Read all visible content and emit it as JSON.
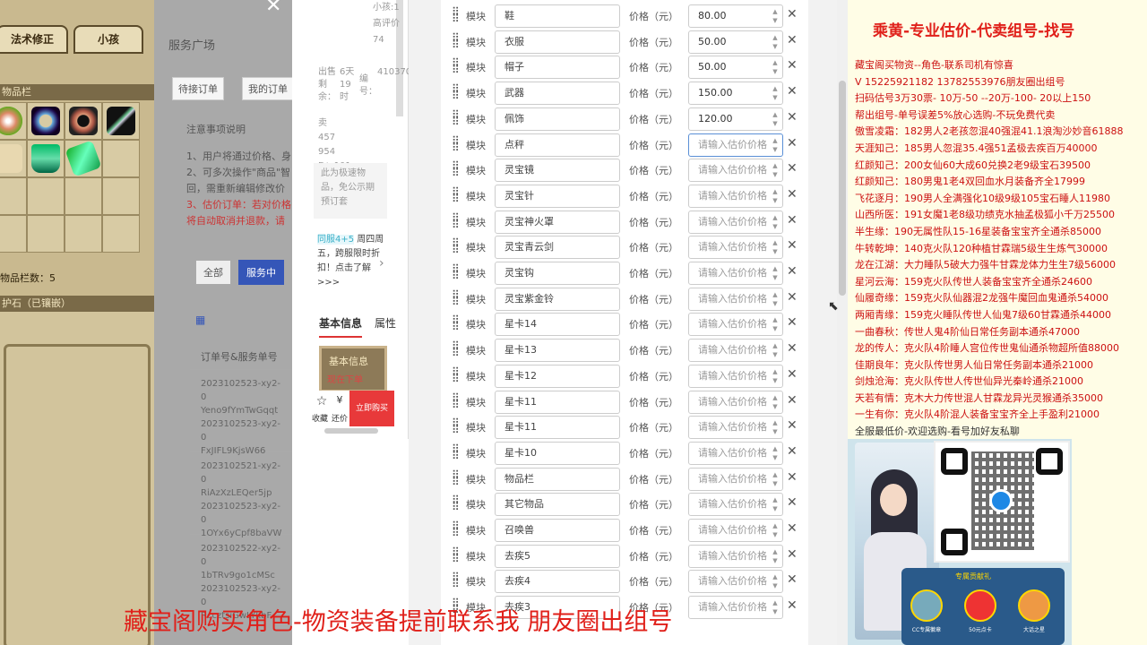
{
  "game": {
    "tab1": "法术修正",
    "tab2": "小孩",
    "bag_title": "物品栏",
    "bag_count": "物品栏数：5",
    "stone_title": "护石（已镶嵌）"
  },
  "service": {
    "title": "服务广场",
    "tab_pending": "待接订单",
    "tab_mine": "我的订单",
    "notes_title": "注意事项说明",
    "note1": "1、用户将通过价格、身",
    "note2": "2、可多次操作\"商品\"智",
    "note3": "回，需重新编辑修改价",
    "note4": "3、估价订单：若对价格",
    "note5": "将自动取消并退款，请",
    "filter_all": "全部",
    "filter_active": "服务中",
    "view_icon": "▦",
    "col_order": "订单号&服务单号",
    "orders": [
      [
        "2023102523-xy2-0",
        "Yeno9fYmTwGqqt",
        "2023102523-xy2-0",
        "FxJIFL9KjsW66"
      ],
      [
        "2023102521-xy2-0",
        "RiAzXzLEQer5jp",
        "2023102523-xy2-0",
        "1OYx6yCpf8baVW"
      ],
      [
        "2023102522-xy2-0",
        "1bTRv9go1cMSc",
        "2023102523-xy2-0",
        "RccztsiGwLYkbF"
      ]
    ]
  },
  "product": {
    "top_small": "小孩:1",
    "top_note": "高评价",
    "top_num": "74",
    "sale_label": "出售剩余：",
    "sale_value": "6天19时",
    "id_label": "编号：",
    "id_value": "410370",
    "stat1": "卖",
    "stat2": "457",
    "stat3": "954",
    "stat4": "D：101",
    "notice": "此为极速物品，免公示期预订套",
    "promo_tag": "同服4+5",
    "promo_text": "周四周五，跨服限时折扣！点击了解>>>",
    "tab_basic": "基本信息",
    "tab_attr": "属性",
    "img_title": "基本信息",
    "img_sub": "现在下单",
    "fav": "收藏",
    "compare": "还价",
    "buy": "立即购买"
  },
  "form": {
    "module_label": "模块",
    "price_label": "价格（元）",
    "placeholder": "请输入估价价格",
    "rows": [
      {
        "name": "鞋",
        "price": "80.00"
      },
      {
        "name": "衣服",
        "price": "50.00"
      },
      {
        "name": "帽子",
        "price": "50.00"
      },
      {
        "name": "武器",
        "price": "150.00"
      },
      {
        "name": "佩饰",
        "price": "120.00"
      },
      {
        "name": "点秤",
        "price": ""
      },
      {
        "name": "灵宝镜",
        "price": ""
      },
      {
        "name": "灵宝针",
        "price": ""
      },
      {
        "name": "灵宝神火罩",
        "price": ""
      },
      {
        "name": "灵宝青云剑",
        "price": ""
      },
      {
        "name": "灵宝钩",
        "price": ""
      },
      {
        "name": "灵宝紫金铃",
        "price": ""
      },
      {
        "name": "星卡14",
        "price": ""
      },
      {
        "name": "星卡13",
        "price": ""
      },
      {
        "name": "星卡12",
        "price": ""
      },
      {
        "name": "星卡11",
        "price": ""
      },
      {
        "name": "星卡11",
        "price": ""
      },
      {
        "name": "星卡10",
        "price": ""
      },
      {
        "name": "物品栏",
        "price": ""
      },
      {
        "name": "其它物品",
        "price": ""
      },
      {
        "name": "召唤兽",
        "price": ""
      },
      {
        "name": "去疾5",
        "price": ""
      },
      {
        "name": "去疾4",
        "price": ""
      },
      {
        "name": "去疾3",
        "price": ""
      }
    ]
  },
  "ad": {
    "title": "乘黄-专业估价-代卖组号-找号",
    "lines": [
      {
        "text": "藏宝阁买物资--角色-联系司机有惊喜",
        "dark": false
      },
      {
        "text": "V 15225921182  13782553976朋友圈出组号",
        "dark": false
      },
      {
        "text": "扫码估号3万30票- 10万-50 --20万-100- 20以上150",
        "dark": false
      },
      {
        "text": "帮出组号-单号误差5%放心选购-不玩免费代卖",
        "dark": false
      },
      {
        "text": "傲雪凌霜：182男人2老孩忽混40强混41.1浪淘沙妙音61888",
        "dark": false
      },
      {
        "text": "天涯知己：185男人忽混35.4强51孟极去疾百万40000",
        "dark": false
      },
      {
        "text": "红颜知己：200女仙60大成60兑换2老9级宝石39500",
        "dark": false
      },
      {
        "text": "红颜知己：180男鬼1老4双回血水月装备齐全17999",
        "dark": false
      },
      {
        "text": "飞花逐月：190男人全满强化10级9级105宝石睡人11980",
        "dark": false
      },
      {
        "text": "山西所医：191女魔1老8级功绩克水抽孟极狐小千万25500",
        "dark": false
      },
      {
        "text": "半生缘：190无属性队15-16星装备宝宝齐全通杀85000",
        "dark": false
      },
      {
        "text": "牛转乾坤：140克火队120种植甘霖瑞5级生生炼气30000",
        "dark": false
      },
      {
        "text": "龙在江湖：大力睡队5破大力强牛甘霖龙体力生生7级56000",
        "dark": false
      },
      {
        "text": "星河云海：159克火队传世人装备宝宝齐全通杀24600",
        "dark": false
      },
      {
        "text": "仙履奇缘：159克火队仙器混2龙强牛魔回血鬼通杀54000",
        "dark": false
      },
      {
        "text": "两厢青缘：159克火睡队传世人仙鬼7级60甘霖通杀44000",
        "dark": false
      },
      {
        "text": "一曲春秋：传世人鬼4阶仙日常任务副本通杀47000",
        "dark": false
      },
      {
        "text": "龙的传人：克火队4阶睡人宫位传世鬼仙通杀物超所值88000",
        "dark": false
      },
      {
        "text": "佳期良年：克火队传世男人仙日常任务副本通杀21000",
        "dark": false
      },
      {
        "text": "剑烛沧海：克火队传世人传世仙异光秦岭通杀21000",
        "dark": false
      },
      {
        "text": "天若有情：克木大力传世混人甘霖龙异光灵猴通杀35000",
        "dark": false
      },
      {
        "text": "一生有你：克火队4阶混人装备宝宝齐全上手盈利21000",
        "dark": false
      },
      {
        "text": "全服最低价-欢迎选购-看号加好友私聊",
        "dark": true
      }
    ],
    "shop_title": "专属贡献礼",
    "badge1": "CC专属徽章",
    "badge2": "50元点卡",
    "badge3": "大话之星"
  },
  "banner": "藏宝阁购买角色-物资装备提前联系我    朋友圈出组号"
}
